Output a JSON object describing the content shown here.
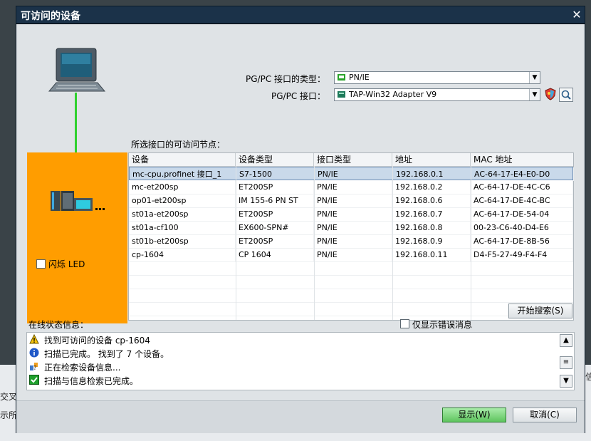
{
  "dialog": {
    "title": "可访问的设备",
    "close": "✕",
    "pgpc_type_label": "PG/PC 接口的类型：",
    "pgpc_type_value": "PN/IE",
    "pgpc_iface_label": "PG/PC 接口：",
    "pgpc_iface_value": "TAP-Win32 Adapter V9",
    "nodes_label": "所选接口的可访问节点：",
    "flash_led_label": "闪烁 LED",
    "start_search_label": "开始搜索(S)",
    "only_errors_label": "仅显示错误消息",
    "status_label": "在线状态信息：",
    "show_button": "显示(W)",
    "cancel_button": "取消(C)"
  },
  "table": {
    "headers": [
      "设备",
      "设备类型",
      "接口类型",
      "地址",
      "MAC 地址"
    ],
    "rows": [
      [
        "mc-cpu.profinet 接口_1",
        "S7-1500",
        "PN/IE",
        "192.168.0.1",
        "AC-64-17-E4-E0-D0"
      ],
      [
        "mc-et200sp",
        "ET200SP",
        "PN/IE",
        "192.168.0.2",
        "AC-64-17-DE-4C-C6"
      ],
      [
        "op01-et200sp",
        "IM 155-6 PN ST",
        "PN/IE",
        "192.168.0.6",
        "AC-64-17-DE-4C-BC"
      ],
      [
        "st01a-et200sp",
        "ET200SP",
        "PN/IE",
        "192.168.0.7",
        "AC-64-17-DE-54-04"
      ],
      [
        "st01a-cf100",
        "EX600-SPN#",
        "PN/IE",
        "192.168.0.8",
        "00-23-C6-40-D4-E6"
      ],
      [
        "st01b-et200sp",
        "ET200SP",
        "PN/IE",
        "192.168.0.9",
        "AC-64-17-DE-8B-56"
      ],
      [
        "cp-1604",
        "CP 1604",
        "PN/IE",
        "192.168.0.11",
        "D4-F5-27-49-F4-F4"
      ]
    ]
  },
  "status": [
    {
      "icon": "warning-icon",
      "text": "找到可访问的设备 cp-1604"
    },
    {
      "icon": "info-icon",
      "text": "扫描已完成。 找到了 7 个设备。"
    },
    {
      "icon": "search-progress-icon",
      "text": "正在检索设备信息..."
    },
    {
      "icon": "check-icon",
      "text": "扫描与信息检索已完成。"
    }
  ],
  "background": {
    "left1": "交叉",
    "left2": "示所",
    "right": "信"
  },
  "colors": {
    "titlebar": "#1b3249",
    "orange_panel": "#ff9d00",
    "link_line": "#2fd12f",
    "selected_row": "#c9d9ea",
    "show_button": "#6fd36f"
  }
}
